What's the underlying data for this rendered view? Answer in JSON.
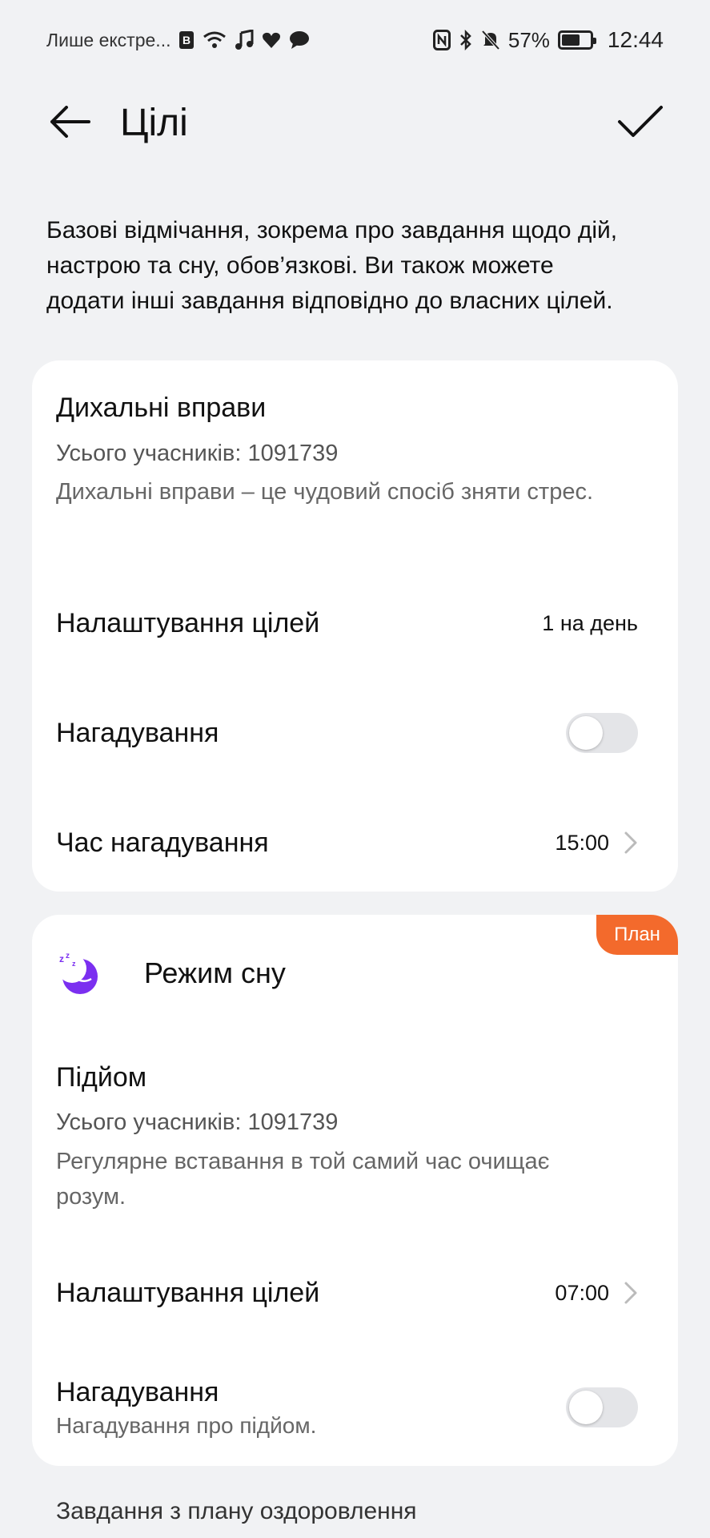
{
  "status_bar": {
    "carrier": "Лише екстре...",
    "battery": "57%",
    "time": "12:44",
    "icons": [
      "sim-b-icon",
      "wifi-icon",
      "music-note-icon",
      "heart-icon",
      "chat-bubble-icon",
      "nfc-icon",
      "bluetooth-icon",
      "bell-off-icon"
    ]
  },
  "header": {
    "title": "Цілі"
  },
  "intro": "Базові відмічання, зокрема про завдання щодо дій, настрою та сну, обов’язкові. Ви також можете додати інші завдання відповідно до власних цілей.",
  "breathing": {
    "title": "Дихальні вправи",
    "participants": "Усього учасників: 1091739",
    "description": "Дихальні вправи – це чудовий спосіб зняти стрес.",
    "goal_label": "Налаштування цілей",
    "goal_value": "1 на день",
    "reminder_label": "Нагадування",
    "reminder_on": false,
    "time_label": "Час нагадування",
    "time_value": "15:00"
  },
  "sleep": {
    "badge": "План",
    "section_title": "Режим сну",
    "title": "Підйом",
    "participants": "Усього учасників: 1091739",
    "description": "Регулярне вставання в той самий час очищає розум.",
    "goal_label": "Налаштування цілей",
    "goal_value": "07:00",
    "reminder_label": "Нагадування",
    "reminder_sub": "Нагадування про підйом.",
    "reminder_on": false
  },
  "footer": {
    "section_title": "Завдання з плану оздоровлення"
  },
  "colors": {
    "accent_badge": "#f36a2c",
    "sleep_icon": "#7b2ff0",
    "background": "#f1f2f4"
  }
}
